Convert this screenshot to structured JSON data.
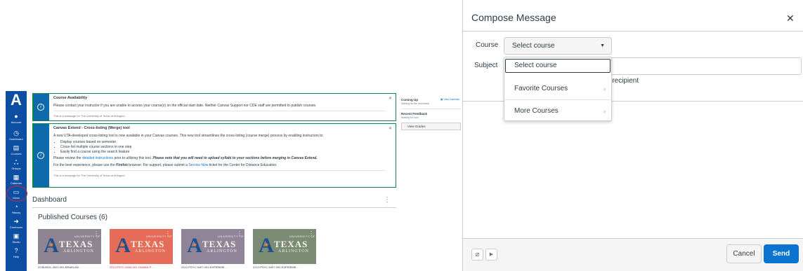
{
  "colors": {
    "nav_bg": "#0b4ea2",
    "accent_blue": "#0b74d0",
    "highlight_red": "#d6243a",
    "card_purple": "#8e8390",
    "card_salmon": "#e56c58",
    "card_purple2": "#908598",
    "card_green": "#7b8b74"
  },
  "nav": {
    "logo_icon": "canvas-logo-icon",
    "items": [
      {
        "label": "Account",
        "icon": "user-icon"
      },
      {
        "label": "Dashboard",
        "icon": "dashboard-icon"
      },
      {
        "label": "Courses",
        "icon": "book-icon"
      },
      {
        "label": "Groups",
        "icon": "group-icon"
      },
      {
        "label": "Calendar",
        "icon": "calendar-icon"
      },
      {
        "label": "Inbox",
        "icon": "inbox-icon"
      },
      {
        "label": "History",
        "icon": "clock-icon"
      },
      {
        "label": "Commons",
        "icon": "commons-icon"
      },
      {
        "label": "Studio",
        "icon": "studio-icon"
      },
      {
        "label": "Help",
        "icon": "help-icon"
      }
    ]
  },
  "announcements": [
    {
      "title": "Course Availability",
      "text": "Please contact your instructor if you are unable to access your course(s) on the official start date. Neither Canvas Support nor CDE staff are permitted to publish courses.",
      "footer": "This is a message for The University of Texas at Arlington"
    },
    {
      "title": "Canvas Extend - Cross-listing (Merge) tool",
      "text": "A new UTA-developed cross-listing tool is now available in your Canvas courses. This new tool streamlines the cross-listing (course merge) process by enabling instructors to:",
      "bullets": [
        "Display courses based on semester",
        "Cross-list multiple course sections in one step",
        "Easily find a course using the search feature"
      ],
      "review_pre": "Please review the ",
      "review_link": "detailed instructions",
      "review_post": " prior to utilizing this tool. ",
      "review_note": "Please note that you will need to upload syllabi to your sections before merging in Canvas Extend.",
      "browser_pre": "For the best experience, please use the ",
      "browser_name": "Firefox",
      "browser_mid": " browser. For support, please submit a ",
      "browser_link": "Service Now",
      "browser_post": " ticket for the Center for Distance Education.",
      "footer": "This is a message for The University of Texas at Arlington"
    }
  ],
  "dashboard": {
    "title": "Dashboard",
    "published_heading": "Published Courses (6)",
    "cards": [
      {
        "title": "2238-BIOL-3322-001-BRAIN AN...",
        "color": "#8e8390",
        "title_color": "#2d3b45"
      },
      {
        "title": "2212-PSYC-5334-001-HUMAN P...",
        "color": "#e56c58",
        "title_color": "#d6243a"
      },
      {
        "title": "2212-PSYC-5407-001-EXPERIME...",
        "color": "#908598",
        "title_color": "#2d3b45"
      },
      {
        "title": "2212-PSYC-5407-002-EXPERIME...",
        "color": "#7b8b74",
        "title_color": "#2d3b45"
      }
    ],
    "card_logo": {
      "university": "UNIVERSITY OF",
      "texas": "TEXAS",
      "arlington": "ARLINGTON"
    }
  },
  "sidebar_right": {
    "coming_up": "Coming Up",
    "view_calendar": "View Calendar",
    "coming_up_empty": "Nothing for the next week",
    "recent_feedback": "Recent Feedback",
    "recent_feedback_empty": "Nothing for now",
    "view_grades": "View Grades"
  },
  "compose": {
    "title": "Compose Message",
    "course_label": "Course",
    "course_value": "Select course",
    "subject_label": "Subject",
    "recipient_note": "ch recipient",
    "menu": {
      "selected": "Select course",
      "items": [
        "Favorite Courses",
        "More Courses"
      ]
    },
    "cancel_label": "Cancel",
    "send_label": "Send"
  }
}
